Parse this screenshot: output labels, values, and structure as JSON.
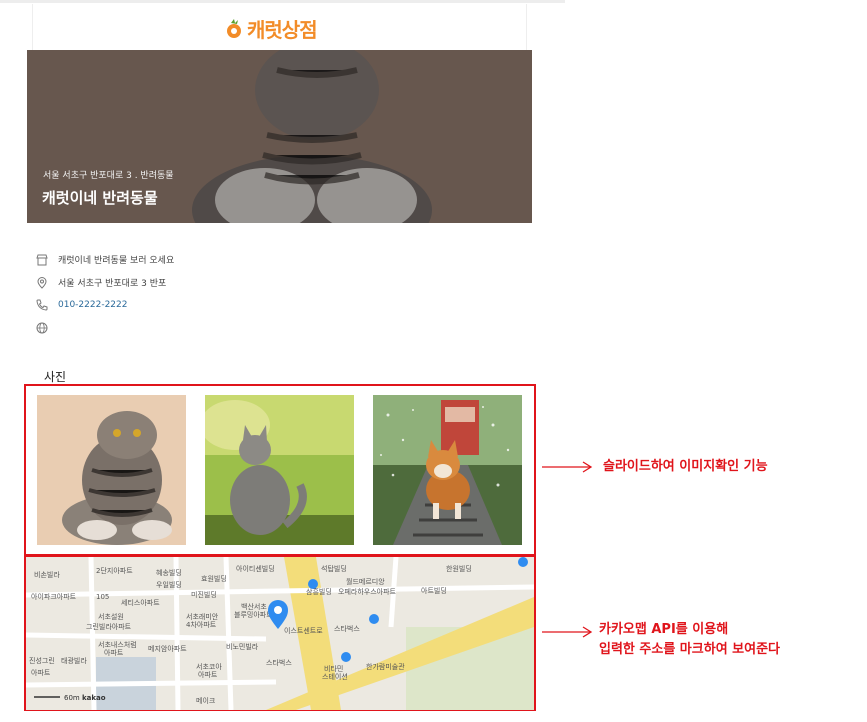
{
  "header": {
    "logo_text": "캐럿상점",
    "logo_icon": "carrot-icon"
  },
  "hero": {
    "subtitle": "서울 서초구 반포대로 3 . 반려동물",
    "title": "캐럿이네 반려동물"
  },
  "info": {
    "description": "캐럿이네 반려동물 보러 오세요",
    "address": "서울 서초구 반포대로 3 반포",
    "phone": "010-2222-2222"
  },
  "photos": {
    "section_title": "사진",
    "items": [
      {
        "subject": "tabby scottish fold cat sitting"
      },
      {
        "subject": "gray kitten in grass looking up"
      },
      {
        "subject": "corgi running on railroad track"
      }
    ]
  },
  "map": {
    "labels": [
      "비손빌라",
      "2단지아파트",
      "혜송빌딩",
      "효원빌딩",
      "아이티센빌딩",
      "석탑빌딩",
      "한원빌딩",
      "우일빌딩",
      "월드메르디앙",
      "오페라하우스아파트",
      "아이파크아파트",
      "105",
      "세티스아파트",
      "미진빌딩",
      "백산서초",
      "블루밍아파트",
      "삼흥빌딩",
      "아트빌딩",
      "서초설원",
      "그린빌라아파트",
      "서초래미안",
      "4차아파트",
      "이스트센트로",
      "스타벅스",
      "서초내스처럼",
      "아파트",
      "메지암아파트",
      "비노민빌라",
      "진성그린",
      "태광빌라",
      "서초코아",
      "아파트",
      "스타벅스",
      "비타민",
      "스테이션",
      "한가람미술관",
      "메이크",
      "아파트"
    ],
    "scale": "60m",
    "brand": "kakao"
  },
  "annotations": [
    {
      "lines": [
        "슬라이드하여 이미지확인 기능"
      ]
    },
    {
      "lines": [
        "카카오맵 API를 이용해",
        "입력한 주소를 마크하여 보여준다"
      ]
    }
  ],
  "colors": {
    "accent": "#f28c28",
    "annotation": "#e0141b",
    "phone": "#2b6a9a",
    "map_pin": "#2f8cf0"
  }
}
